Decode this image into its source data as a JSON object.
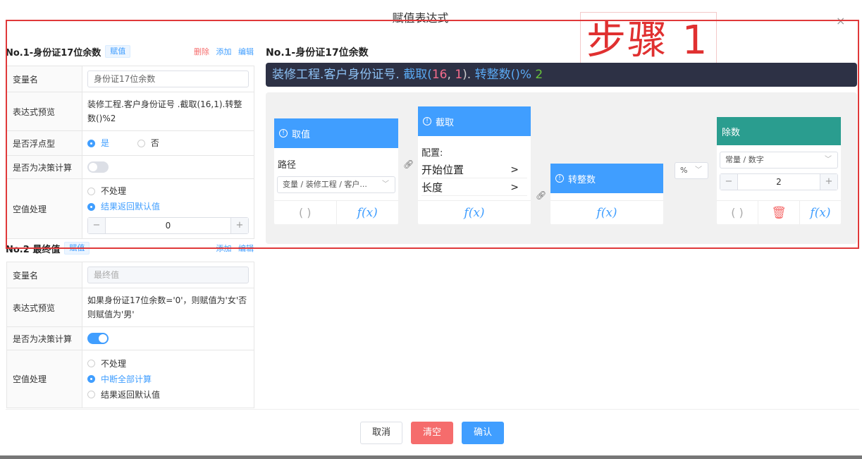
{
  "dialog": {
    "title": "赋值表达式",
    "close_symbol": "×"
  },
  "annotation": {
    "text": "步骤 1"
  },
  "section1": {
    "name": "No.1-身份证17位余数",
    "tag": "赋值",
    "links": {
      "delete": "删除",
      "add": "添加",
      "edit": "编辑"
    },
    "rows": {
      "varname_label": "变量名",
      "varname_value": "身份证17位余数",
      "preview_label": "表达式预览",
      "preview_value": "装修工程.客户身份证号 .截取(16,1).转整数()%2",
      "float_label": "是否浮点型",
      "float_yes": "是",
      "float_no": "否",
      "decision_label": "是否为决策计算",
      "null_label": "空值处理",
      "null_opt1": "不处理",
      "null_opt2": "结果返回默认值",
      "default_value": "0"
    }
  },
  "section2": {
    "name": "No.2 最终值",
    "tag": "赋值",
    "links": {
      "add": "添加",
      "edit": "编辑"
    },
    "rows": {
      "varname_label": "变量名",
      "varname_placeholder": "最终值",
      "preview_label": "表达式预览",
      "preview_value": "如果身份证17位余数='0'，则赋值为'女'否则赋值为'男'",
      "decision_label": "是否为决策计算",
      "null_label": "空值处理",
      "null_opt1": "不处理",
      "null_opt2": "中断全部计算",
      "null_opt3": "结果返回默认值"
    }
  },
  "editor": {
    "title": "No.1-身份证17位余数",
    "expr": {
      "path": "装修工程.客户身份证号.",
      "fn1": "截取(",
      "n1": "16",
      "comma": ", ",
      "n2": "1",
      "close1": ").",
      "fn2": "转整数()",
      "op": "% ",
      "num": "2"
    },
    "nodes": {
      "value": {
        "title": "取值",
        "path_label": "路径",
        "path_value": "变量 / 装修工程 / 客户...",
        "paren": "( )",
        "fx": "f(x)"
      },
      "substr": {
        "title": "截取",
        "config_label": "配置:",
        "start": "开始位置",
        "length": "长度",
        "fx": "f(x)"
      },
      "toint": {
        "title": "转整数",
        "fx": "f(x)"
      },
      "op_select": "%",
      "divisor": {
        "title": "除数",
        "type_value": "常量 / 数字",
        "value": "2",
        "paren": "( )",
        "fx": "f(x)"
      }
    }
  },
  "footer": {
    "cancel": "取消",
    "clear": "清空",
    "confirm": "确认"
  },
  "colors": {
    "primary": "#409eff",
    "danger": "#f56c6c",
    "teal": "#2a9d8f",
    "annotation_red": "#e0393a",
    "expr_bg": "#2d3145"
  }
}
